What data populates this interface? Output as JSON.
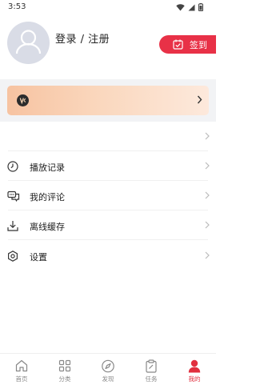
{
  "status": {
    "time": "3:53"
  },
  "profile": {
    "login_label": "登录 / 注册"
  },
  "signin": {
    "label": "签到"
  },
  "menu": [
    {
      "label": ""
    },
    {
      "label": "播放记录"
    },
    {
      "label": "我的评论"
    },
    {
      "label": "离线缓存"
    },
    {
      "label": "设置"
    }
  ],
  "tabs": [
    {
      "label": "首页"
    },
    {
      "label": "分类"
    },
    {
      "label": "发现"
    },
    {
      "label": "任务"
    },
    {
      "label": "我的"
    }
  ],
  "colors": {
    "accent": "#e83147",
    "active_tab": "#e1303f"
  }
}
